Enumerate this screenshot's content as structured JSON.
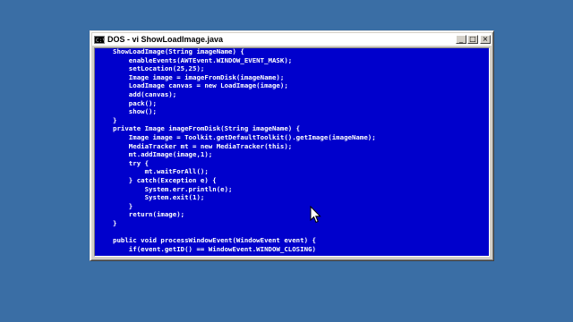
{
  "window": {
    "title": "DOS - vi ShowLoadImage.java",
    "icon_label": "C:\\",
    "buttons": {
      "minimize": "_",
      "maximize": "□",
      "close": "×"
    }
  },
  "editor": {
    "lines": [
      "ShowLoadImage(String imageName) {",
      "    enableEvents(AWTEvent.WINDOW_EVENT_MASK);",
      "    setLocation(25,25);",
      "    Image image = imageFromDisk(imageName);",
      "    LoadImage canvas = new LoadImage(image);",
      "    add(canvas);",
      "    pack();",
      "    show();",
      "}",
      "private Image imageFromDisk(String imageName) {",
      "    Image image = Toolkit.getDefaultToolkit().getImage(imageName);",
      "    MediaTracker mt = new MediaTracker(this);",
      "    mt.addImage(image,1);",
      "    try {",
      "        mt.waitForAll();",
      "    } catch(Exception e) {",
      "        System.err.println(e);",
      "        System.exit(1);",
      "    }",
      "    return(image);",
      "}",
      "",
      "public void processWindowEvent(WindowEvent event) {",
      "    if(event.getID() == WindowEvent.WINDOW_CLOSING)"
    ]
  },
  "colors": {
    "desktop": "#3a6ea5",
    "console_bg": "#0000cc",
    "console_text": "#ffffff"
  }
}
